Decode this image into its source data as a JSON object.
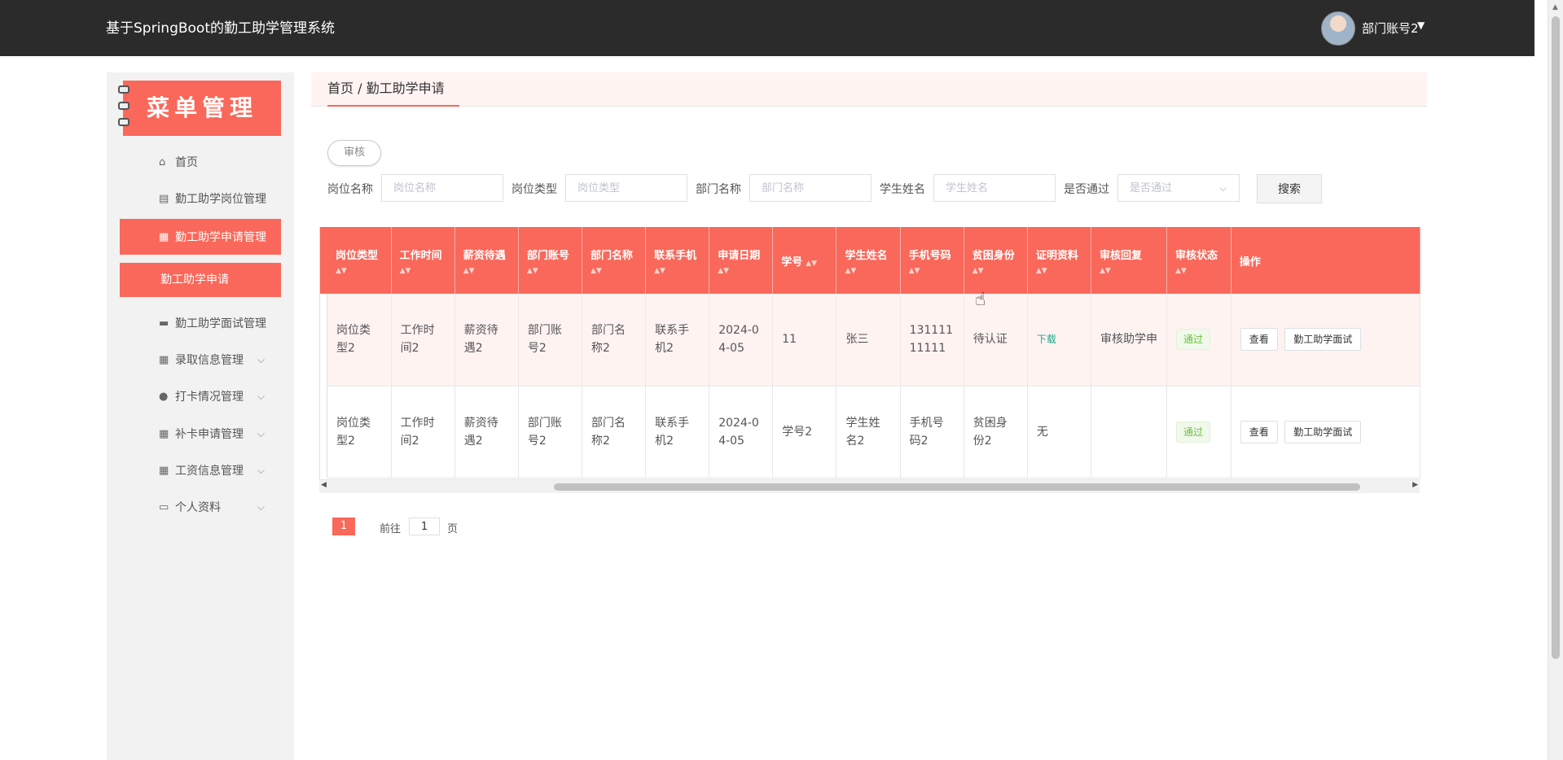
{
  "app": {
    "title": "基于SpringBoot的勤工助学管理系统",
    "user": "部门账号2"
  },
  "sidebar": {
    "banner": "菜单管理",
    "items": [
      {
        "label": "首页",
        "icon": "home-icon"
      },
      {
        "label": "勤工助学岗位管理",
        "icon": "clipboard-icon"
      },
      {
        "label": "勤工助学申请管理",
        "icon": "grid-icon"
      },
      {
        "label": "勤工助学申请",
        "icon": ""
      },
      {
        "label": "勤工助学面试管理",
        "icon": "chat-icon"
      },
      {
        "label": "录取信息管理",
        "icon": "grid-icon"
      },
      {
        "label": "打卡情况管理",
        "icon": "user-icon"
      },
      {
        "label": "补卡申请管理",
        "icon": "grid-icon"
      },
      {
        "label": "工资信息管理",
        "icon": "grid-icon"
      },
      {
        "label": "个人资料",
        "icon": "card-icon"
      }
    ]
  },
  "breadcrumb": "首页 / 勤工助学申请",
  "toolbar": {
    "audit_label": "审核"
  },
  "filters": {
    "position_name": {
      "label": "岗位名称",
      "placeholder": "岗位名称"
    },
    "position_type": {
      "label": "岗位类型",
      "placeholder": "岗位类型"
    },
    "department_name": {
      "label": "部门名称",
      "placeholder": "部门名称"
    },
    "student_name": {
      "label": "学生姓名",
      "placeholder": "学生姓名"
    },
    "passed": {
      "label": "是否通过",
      "placeholder": "是否通过"
    },
    "search_label": "搜索"
  },
  "table": {
    "headers": [
      "岗位类型",
      "工作时间",
      "薪资待遇",
      "部门账号",
      "部门名称",
      "联系手机",
      "申请日期",
      "学号",
      "学生姓名",
      "手机号码",
      "贫困身份",
      "证明资料",
      "审核回复",
      "审核状态",
      "操作"
    ],
    "rows": [
      {
        "cells": [
          "岗位类型2",
          "工作时间2",
          "薪资待遇2",
          "部门账号2",
          "部门名称2",
          "联系手机2",
          "2024-04-05",
          "11",
          "张三",
          "13111111111",
          "待认证",
          "下载",
          "审核助学申",
          "通过"
        ]
      },
      {
        "cells": [
          "岗位类型2",
          "工作时间2",
          "薪资待遇2",
          "部门账号2",
          "部门名称2",
          "联系手机2",
          "2024-04-05",
          "学号2",
          "学生姓名2",
          "手机号码2",
          "贫困身份2",
          "无",
          "",
          "通过"
        ]
      }
    ],
    "actions": {
      "view": "查看",
      "interview": "勤工助学面试"
    }
  },
  "pagination": {
    "current": "1",
    "goto_prefix": "前往",
    "goto_value": "1",
    "goto_suffix": "页"
  },
  "colors": {
    "accent": "#f9685a",
    "topbar": "#2b2b2b",
    "sidebar_bg": "#f2f2f2"
  }
}
